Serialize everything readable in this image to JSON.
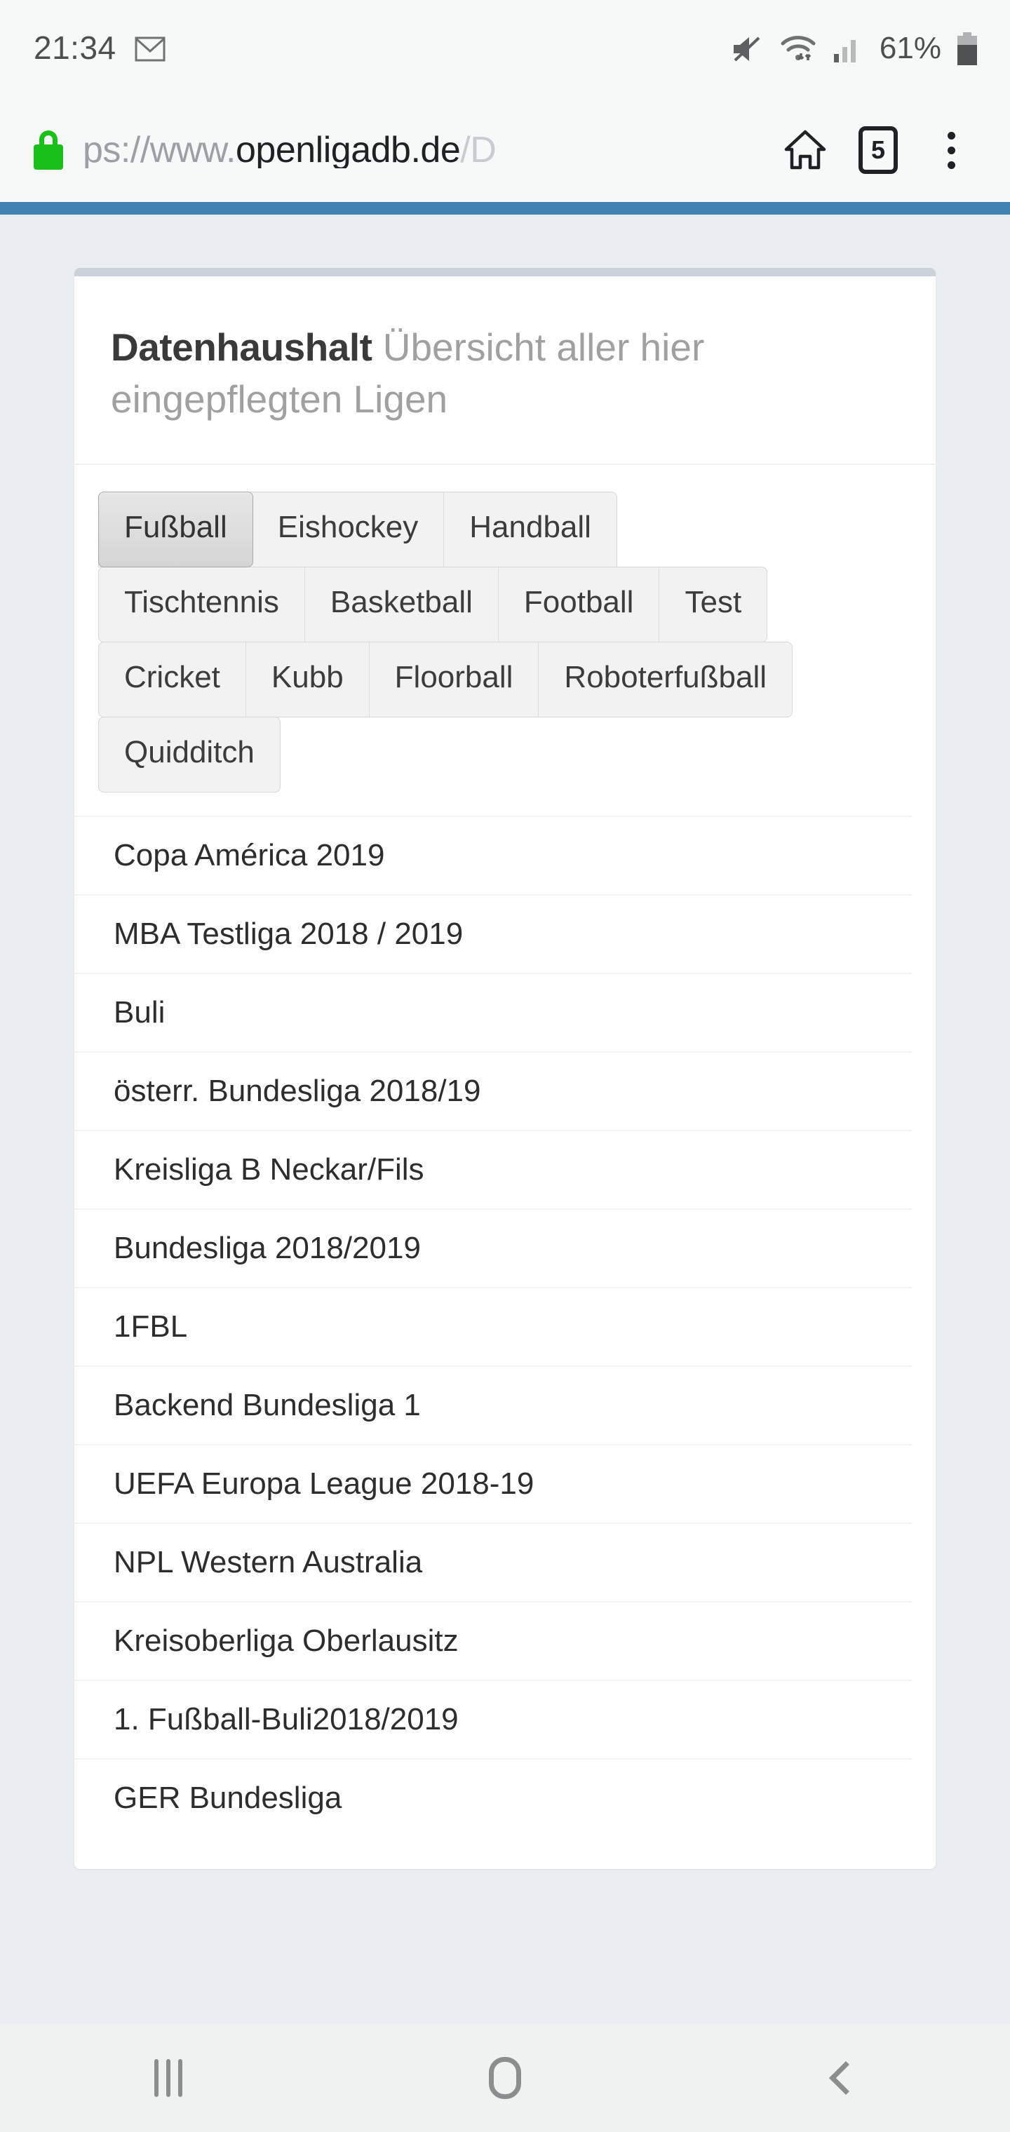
{
  "status_bar": {
    "clock": "21:34",
    "battery_percent": "61%",
    "icons": [
      "envelope-icon",
      "mute-icon",
      "wifi-icon",
      "signal-icon",
      "battery-icon"
    ]
  },
  "browser": {
    "url_prefix_dim": "ps://www.",
    "url_host": "openligadb.de",
    "url_path_dim": "/D",
    "url_full": "ps://www.openligadb.de/D",
    "secure_label": "lock-icon",
    "home_label": "home-icon",
    "tab_count": "5",
    "menu_label": "more-options-icon",
    "accent_color": "#3d85b0"
  },
  "page": {
    "heading_title": "Datenhaushalt",
    "heading_subtitle": "Übersicht aller hier eingepflegten Ligen",
    "background_color": "#eaeef2"
  },
  "sport_tabs": {
    "active": "Fußball",
    "rows": [
      [
        "Fußball",
        "Eishockey",
        "Handball"
      ],
      [
        "Tischtennis",
        "Basketball",
        "Football",
        "Test"
      ],
      [
        "Cricket",
        "Kubb",
        "Floorball",
        "Roboterfußball"
      ],
      [
        "Quidditch"
      ]
    ]
  },
  "leagues": [
    "Copa América 2019",
    "MBA Testliga 2018 / 2019",
    "Buli",
    "österr. Bundesliga 2018/19",
    "Kreisliga B Neckar/Fils",
    "Bundesliga 2018/2019",
    "1FBL",
    "Backend Bundesliga 1",
    "UEFA Europa League 2018-19",
    "NPL Western Australia",
    "Kreisoberliga Oberlausitz",
    "1. Fußball-Buli2018/2019",
    "GER Bundesliga"
  ],
  "nav_bar": {
    "recents_label": "recent-apps-icon",
    "home_label": "home-icon",
    "back_label": "back-icon"
  }
}
